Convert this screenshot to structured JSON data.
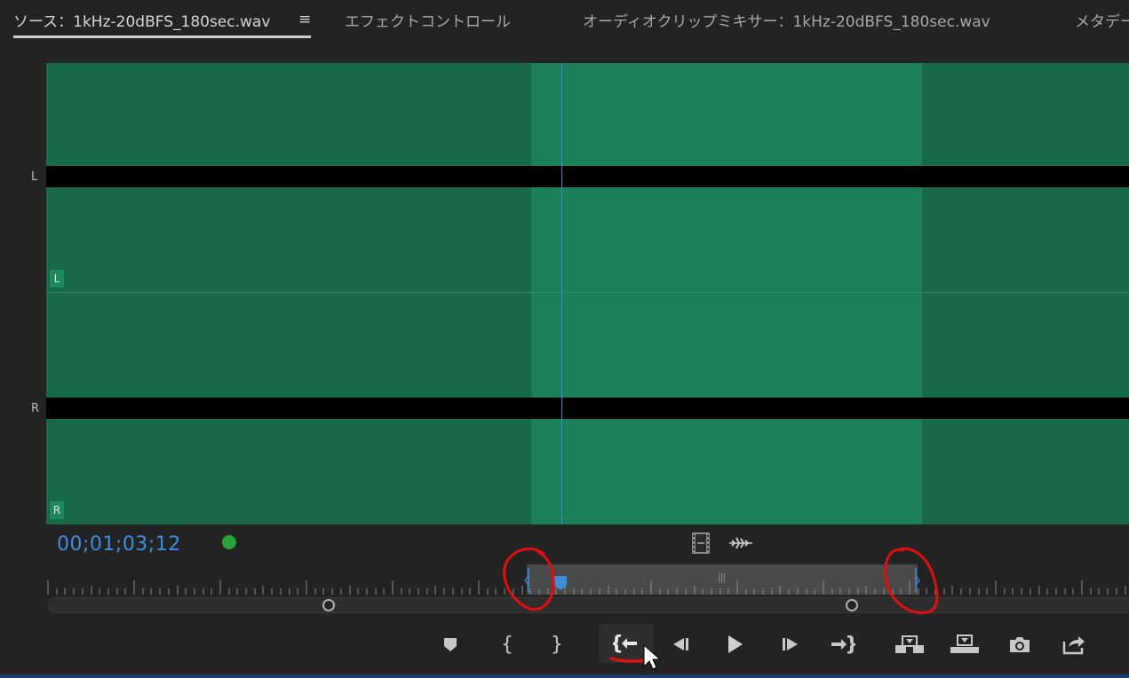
{
  "tabs": [
    {
      "label": "ソース：1kHz-20dBFS_180sec.wav",
      "active": true
    },
    {
      "label": "エフェクトコントロール",
      "active": false
    },
    {
      "label": "オーディオクリップミキサー：1kHz-20dBFS_180sec.wav",
      "active": false
    },
    {
      "label": "メタデータ",
      "active": false
    }
  ],
  "tab_menu_glyph": "≡",
  "waveform": {
    "side_labels": [
      "L",
      "R"
    ],
    "channel_tags": [
      "L",
      "R"
    ],
    "colors": {
      "outside": "#18684a",
      "inout": "#1b805a",
      "playhead": "#3d8bd9"
    }
  },
  "timecode": "00;01;03;12",
  "status_color": "#27a33a",
  "ruler": {
    "center_marker": "|||"
  },
  "transport": {
    "buttons": [
      "marker-icon",
      "mark-in-icon",
      "mark-out-icon",
      "go-to-in-icon",
      "step-back-icon",
      "play-icon",
      "step-forward-icon",
      "go-to-out-icon",
      "insert-icon",
      "overwrite-icon",
      "camera-icon",
      "export-icon"
    ]
  },
  "annotation_color": "#e01010"
}
